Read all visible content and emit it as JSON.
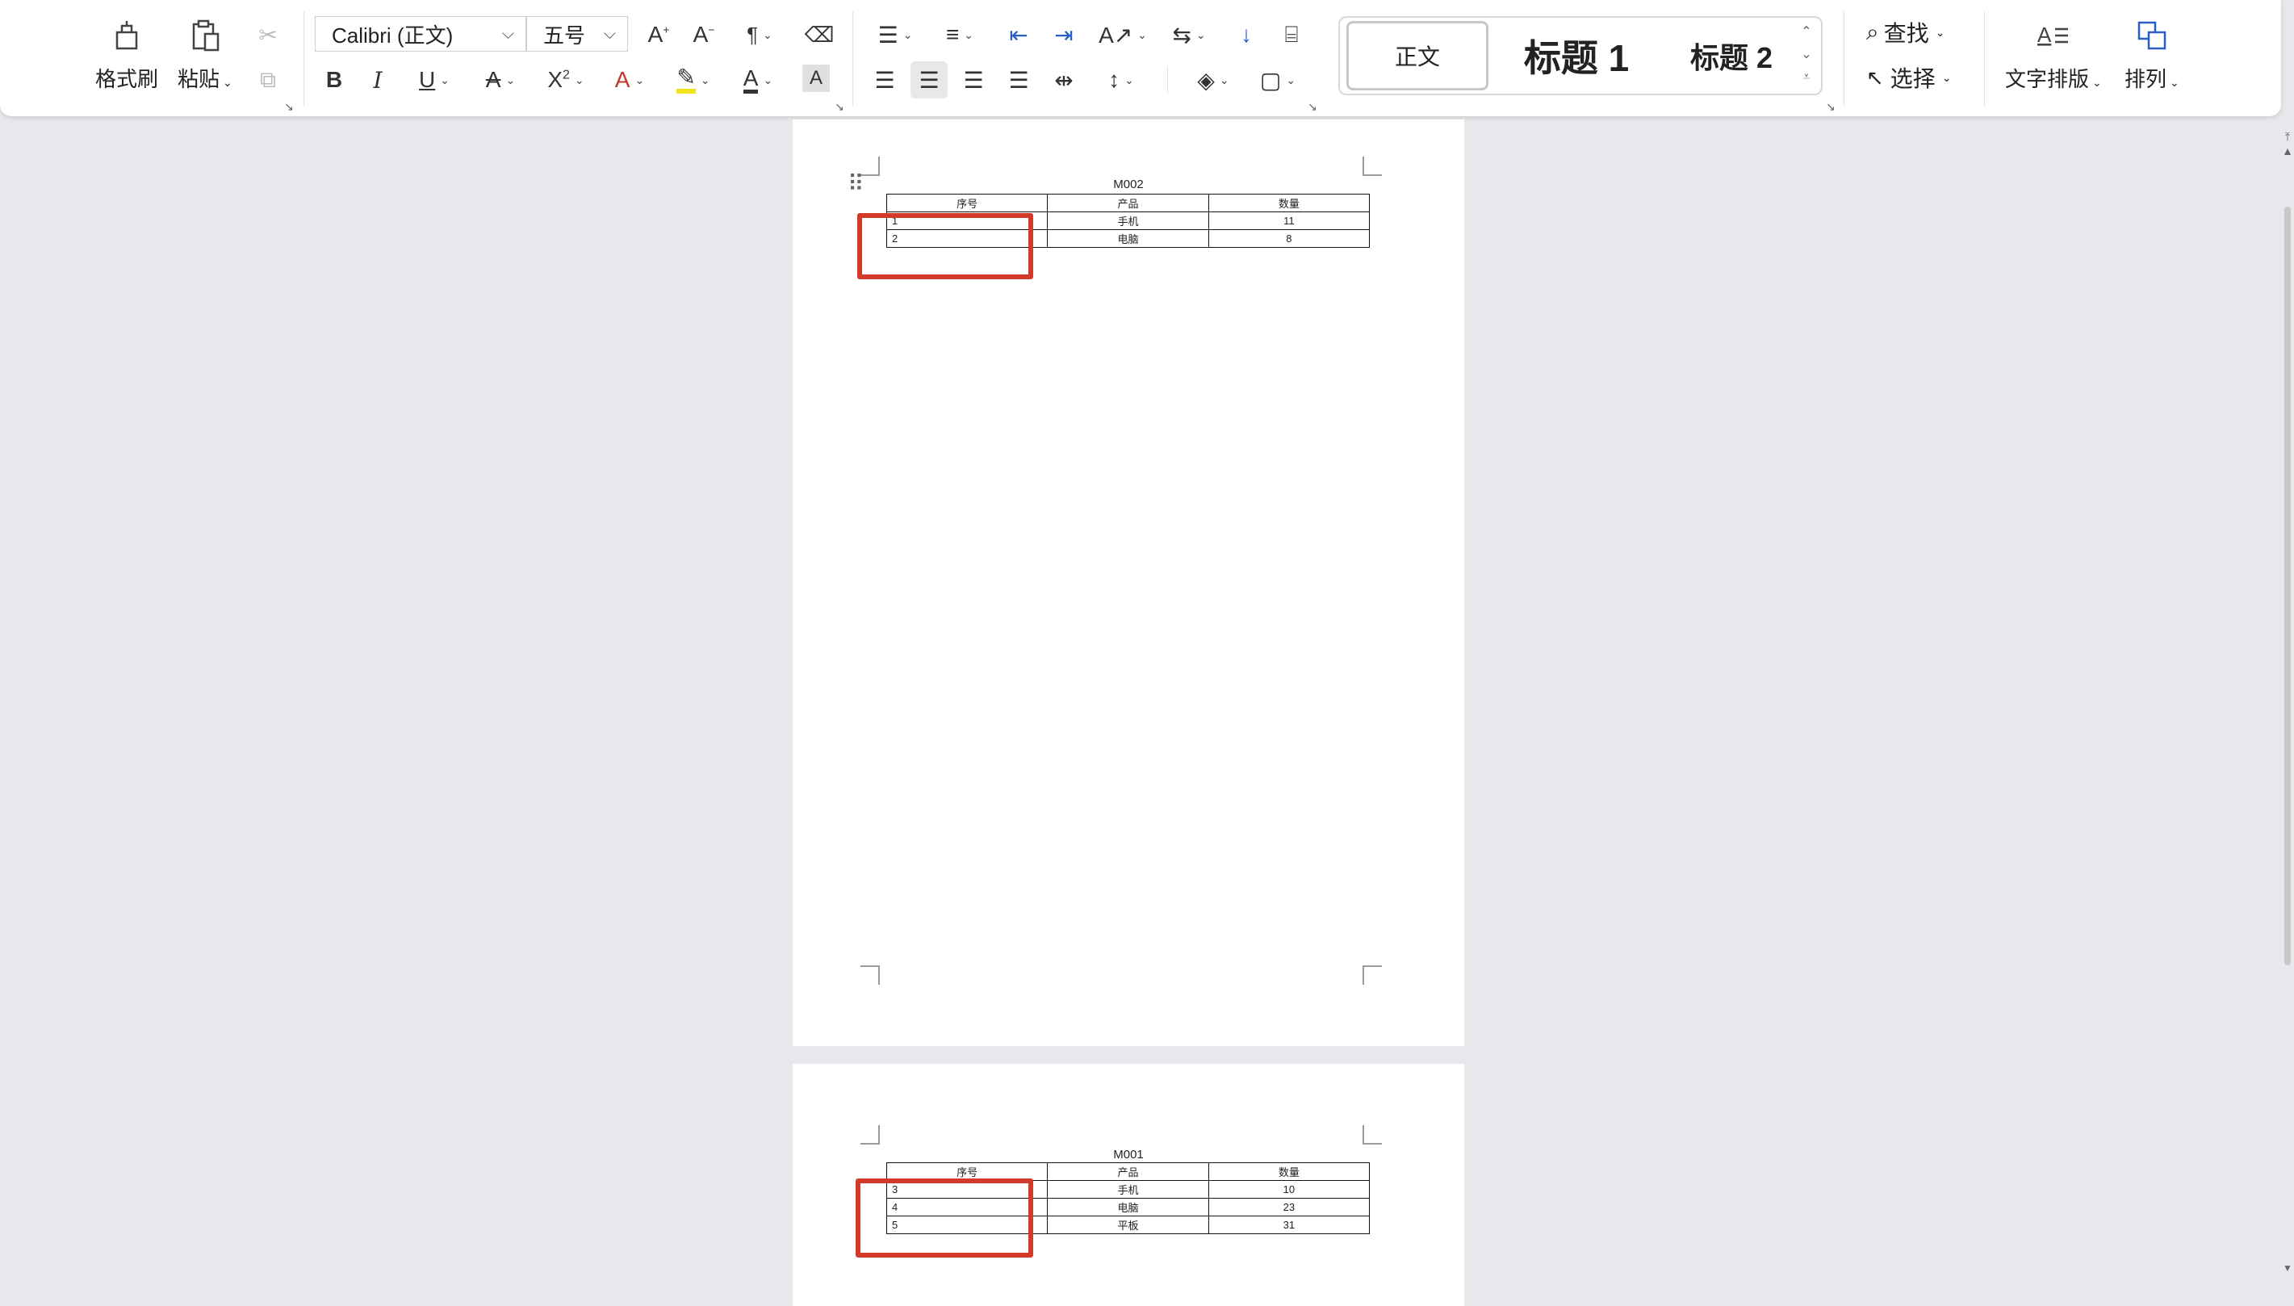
{
  "ribbon": {
    "clipboard": {
      "format_painter": "格式刷",
      "paste": "粘贴"
    },
    "font": {
      "family": "Calibri (正文)",
      "size": "五号"
    },
    "styles": {
      "normal": "正文",
      "heading1": "标题 1",
      "heading2": "标题 2"
    },
    "editing": {
      "find": "查找",
      "select": "选择"
    },
    "layout": {
      "text_layout": "文字排版",
      "arrange": "排列"
    }
  },
  "colors": {
    "highlight_box": "#d23a2a",
    "highlighter_yellow": "#f3e21c",
    "page_bg": "#ffffff",
    "workspace_bg": "#e7e8eb"
  },
  "document": {
    "page1": {
      "table_title": "M002",
      "headers": [
        "序号",
        "产品",
        "数量"
      ],
      "rows": [
        {
          "no": "1",
          "product": "手机",
          "qty": "11"
        },
        {
          "no": "2",
          "product": "电脑",
          "qty": "8"
        }
      ]
    },
    "page2": {
      "table_title": "M001",
      "headers": [
        "序号",
        "产品",
        "数量"
      ],
      "rows": [
        {
          "no": "3",
          "product": "手机",
          "qty": "10"
        },
        {
          "no": "4",
          "product": "电脑",
          "qty": "23"
        },
        {
          "no": "5",
          "product": "平板",
          "qty": "31"
        }
      ]
    }
  }
}
